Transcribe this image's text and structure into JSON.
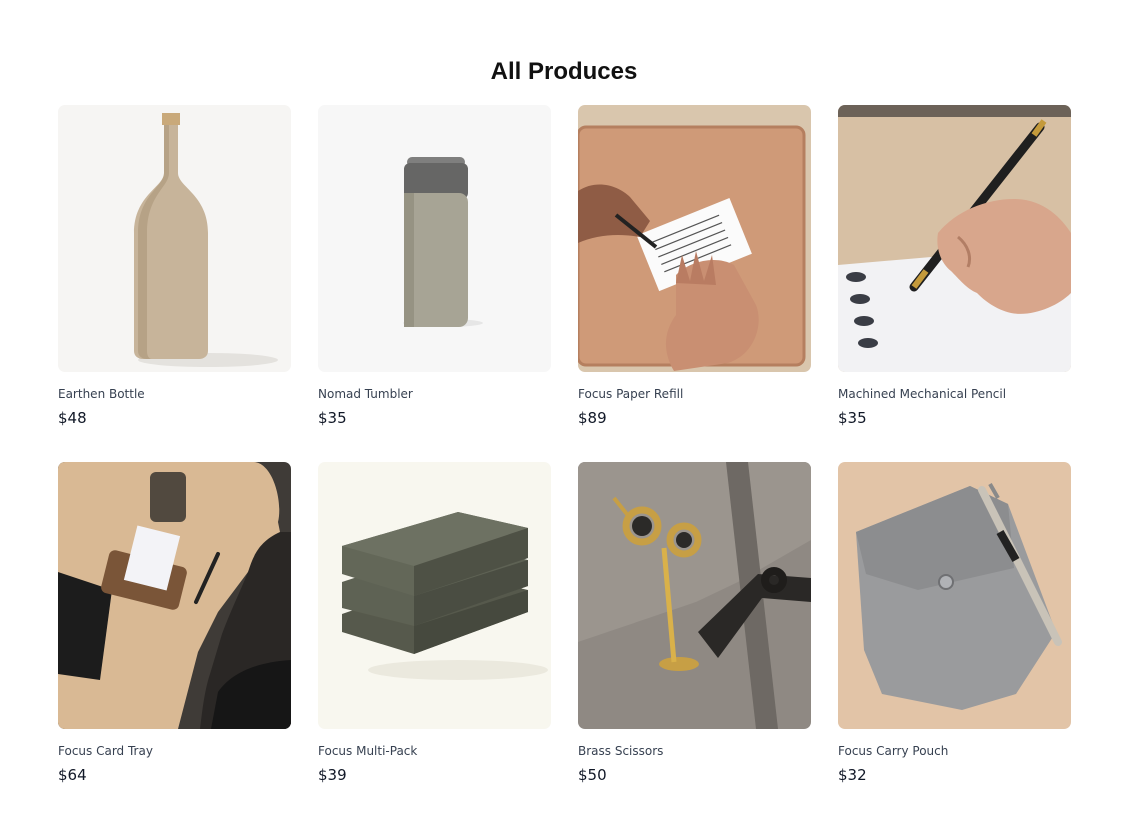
{
  "page": {
    "title": "All Produces"
  },
  "products": [
    {
      "name": "Earthen Bottle",
      "price": "$48",
      "icon": "earthen-bottle-image"
    },
    {
      "name": "Nomad Tumbler",
      "price": "$35",
      "icon": "nomad-tumbler-image"
    },
    {
      "name": "Focus Paper Refill",
      "price": "$89",
      "icon": "paper-refill-image"
    },
    {
      "name": "Machined Mechanical Pencil",
      "price": "$35",
      "icon": "mechanical-pencil-image"
    },
    {
      "name": "Focus Card Tray",
      "price": "$64",
      "icon": "card-tray-image"
    },
    {
      "name": "Focus Multi-Pack",
      "price": "$39",
      "icon": "multi-pack-image"
    },
    {
      "name": "Brass Scissors",
      "price": "$50",
      "icon": "brass-scissors-image"
    },
    {
      "name": "Focus Carry Pouch",
      "price": "$32",
      "icon": "carry-pouch-image"
    }
  ],
  "colors": {
    "text": "#111827",
    "muted": "#374151",
    "background": "#ffffff"
  }
}
